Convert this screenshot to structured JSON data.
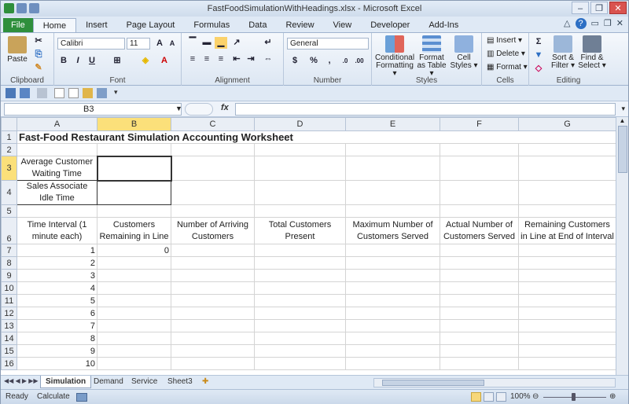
{
  "window": {
    "title": "FastFoodSimulationWithHeadings.xlsx - Microsoft Excel"
  },
  "tabs": [
    "File",
    "Home",
    "Insert",
    "Page Layout",
    "Formulas",
    "Data",
    "Review",
    "View",
    "Developer",
    "Add-Ins"
  ],
  "ribbon": {
    "clipboard": {
      "label": "Clipboard",
      "paste": "Paste"
    },
    "font": {
      "label": "Font",
      "name": "Calibri",
      "size": "11"
    },
    "alignment": {
      "label": "Alignment"
    },
    "number": {
      "label": "Number",
      "format": "General"
    },
    "styles": {
      "label": "Styles",
      "conditional": "Conditional Formatting ▾",
      "as_table": "Format as Table ▾",
      "cell_styles": "Cell Styles ▾"
    },
    "cells": {
      "label": "Cells",
      "insert": "Insert ▾",
      "delete": "Delete ▾",
      "format": "Format ▾"
    },
    "editing": {
      "label": "Editing",
      "sort": "Sort & Filter ▾",
      "find": "Find & Select ▾"
    }
  },
  "formula_bar": {
    "name_box": "B3",
    "fx": "fx",
    "formula": ""
  },
  "columns": [
    "A",
    "B",
    "C",
    "D",
    "E",
    "F",
    "G"
  ],
  "sheet": {
    "title": "Fast-Food Restaurant Simulation Accounting Worksheet",
    "row3_label": "Average Customer Waiting Time",
    "row4_label": "Sales Associate Idle Time",
    "headers": [
      "Time Interval   (1 minute each)",
      "Customers Remaining in Line",
      "Number of Arriving Customers",
      "Total Customers Present",
      "Maximum Number of Customers Served",
      "Actual Number of Customers Served",
      "Remaining Customers in Line at End of Interval"
    ],
    "b7": "0",
    "intervals": [
      "1",
      "2",
      "3",
      "4",
      "5",
      "6",
      "7",
      "8",
      "9",
      "10"
    ]
  },
  "row_numbers": [
    "1",
    "2",
    "3",
    "4",
    "5",
    "6",
    "7",
    "8",
    "9",
    "10",
    "11",
    "12",
    "13",
    "14",
    "15",
    "16"
  ],
  "sheet_tabs": [
    "Simulation",
    "Demand",
    "Service",
    "Sheet3"
  ],
  "status": {
    "ready": "Ready",
    "calculate": "Calculate",
    "zoom": "100%"
  }
}
